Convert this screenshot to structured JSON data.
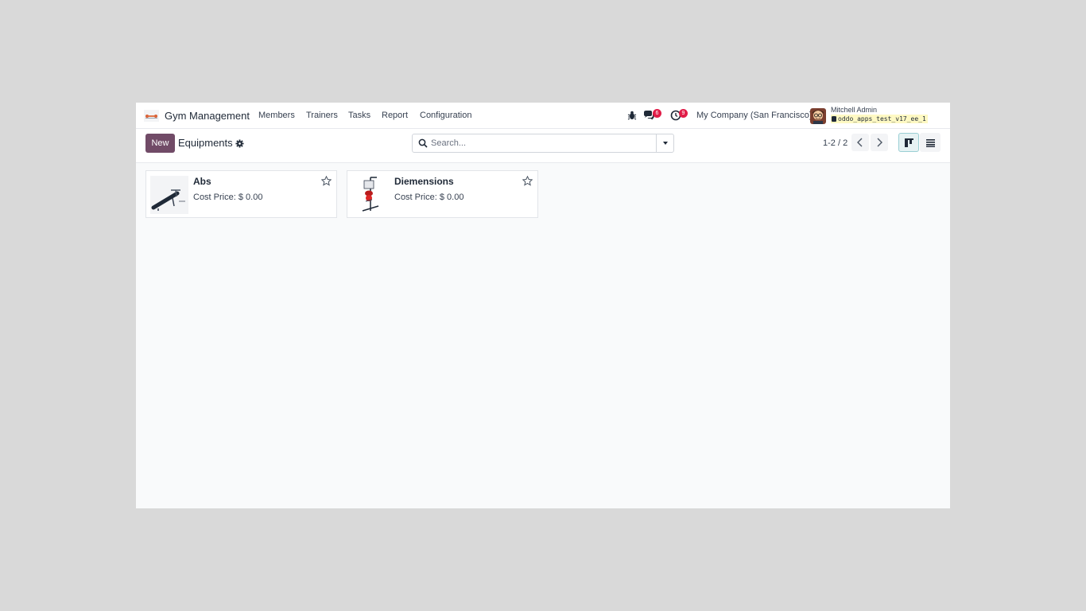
{
  "navbar": {
    "app_name": "Gym Management",
    "menu": [
      "Members",
      "Trainers",
      "Tasks",
      "Report",
      "Configuration"
    ],
    "messages_count": "6",
    "activities_count": "9",
    "company": "My Company (San Francisco)",
    "user_name": "Mitchell Admin",
    "database": "oddo_apps_test_v17_ee_1"
  },
  "control": {
    "new_label": "New",
    "breadcrumb": "Equipments",
    "search_placeholder": "Search...",
    "pager": "1-2 / 2"
  },
  "cards": [
    {
      "title": "Abs",
      "price": "Cost Price: $ 0.00",
      "image_icon": "abs-bench-image"
    },
    {
      "title": "Diemensions",
      "price": "Cost Price: $ 0.00",
      "image_icon": "punching-stand-image"
    }
  ],
  "colors": {
    "brand": "#714b67",
    "badge": "#e11d48",
    "active_view": "#e6f2f3"
  }
}
